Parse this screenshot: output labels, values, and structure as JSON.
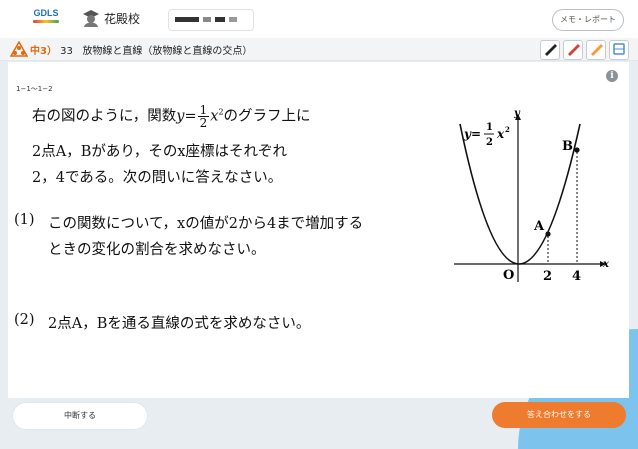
{
  "header": {
    "logo_text": "GDLS",
    "school_name": "花殿校",
    "memo_button": "メモ・レポート"
  },
  "titlebar": {
    "grade": "中3）",
    "number": "33",
    "title": "放物線と直線（放物線と直線の交点）"
  },
  "problem": {
    "id": "1−1〜1−2",
    "intro_line1_pre": "右の図のように，関数",
    "intro_line1_post": "のグラフ上に",
    "intro_line2": "2点A，Bがあり，そのx座標はそれぞれ",
    "intro_line3": "2，4である。次の問いに答えなさい。",
    "q1_label": "(1)",
    "q1_line1": "この関数について，xの値が2から4まで増加する",
    "q1_line2": "ときの変化の割合を求めなさい。",
    "q2_label": "(2)",
    "q2_text": "2点A，Bを通る直線の式を求めなさい。"
  },
  "graph": {
    "y_label": "y",
    "x_label": "x",
    "origin_label": "O",
    "eq_lhs": "y=",
    "frac_num": "1",
    "frac_den": "2",
    "eq_var": "x",
    "point_a": "A",
    "point_b": "B",
    "tick_2": "2",
    "tick_4": "4"
  },
  "footer": {
    "pause_button": "中断する",
    "answer_button": "答え合わせをする"
  },
  "colors": {
    "accent_orange": "#ee7b2e",
    "background_blue": "#7cc4ee"
  }
}
